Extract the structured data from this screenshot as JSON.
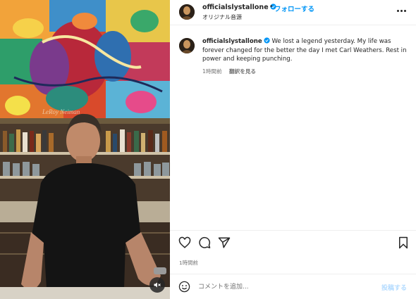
{
  "post": {
    "username": "officialslystallone",
    "follow_label": "フォローする",
    "separator": "•",
    "audio_label": "オリジナル音源",
    "caption": "We lost a legend yesterday. My life was forever changed for the better the day I met Carl Weathers. Rest in power and keeping punching.",
    "caption_time": "1時間前",
    "see_translation": "翻訳を見る",
    "posted_time": "1時間前"
  },
  "comment": {
    "placeholder": "コメントを追加...",
    "post_label": "投稿する"
  },
  "colors": {
    "link_blue": "#0095f6",
    "post_disabled": "#b3dbff",
    "verified_blue": "#0095f6",
    "text": "#262626",
    "muted": "#737373"
  },
  "icons": [
    "verified-badge-icon",
    "more-options-icon",
    "heart-icon",
    "comment-icon",
    "share-icon",
    "bookmark-icon",
    "emoji-icon",
    "mute-icon"
  ]
}
